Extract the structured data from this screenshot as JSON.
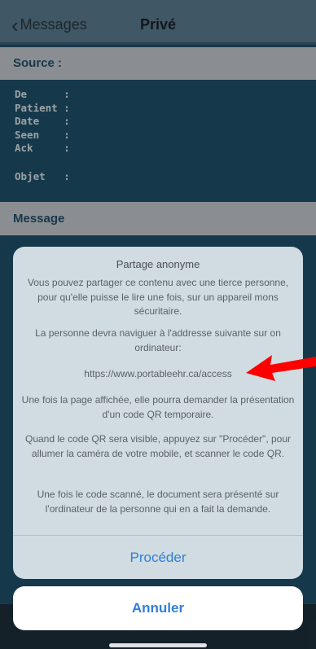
{
  "nav": {
    "back_label": "Messages",
    "title": "Privé"
  },
  "source": {
    "header": "Source :",
    "rows": [
      {
        "label": "De      :"
      },
      {
        "label": "Patient :"
      },
      {
        "label": "Date    :"
      },
      {
        "label": "Seen    :"
      },
      {
        "label": "Ack     :"
      }
    ],
    "subject": "Objet   :"
  },
  "message": {
    "header": "Message"
  },
  "sheet": {
    "title": "Partage anonyme",
    "p1": "Vous pouvez partager ce contenu avec une tierce personne, pour qu'elle puisse le lire une fois, sur un appareil mons sécuritaire.",
    "p2": "La personne devra naviguer à l'addresse suivante sur on ordinateur:",
    "url": "https://www.portableehr.ca/access",
    "p3": "Une fois la page affichée, elle pourra demander la présentation d'un code QR temporaire.",
    "p4": "Quand le code QR sera visible, appuyez sur \"Procéder\", pour allumer la caméra de votre mobile, et scanner le code QR.",
    "p5": "Une fois le code scanné, le document sera présenté sur l'ordinateur de la personne qui en a fait la demande.",
    "proceed_label": "Procéder"
  },
  "cancel_label": "Annuler",
  "colors": {
    "accent": "#2f7fd9",
    "arrow": "#ff0000",
    "background": "#1d4d63"
  },
  "icons": {
    "back": "chevron-left-icon",
    "arrow": "red-arrow-icon"
  }
}
